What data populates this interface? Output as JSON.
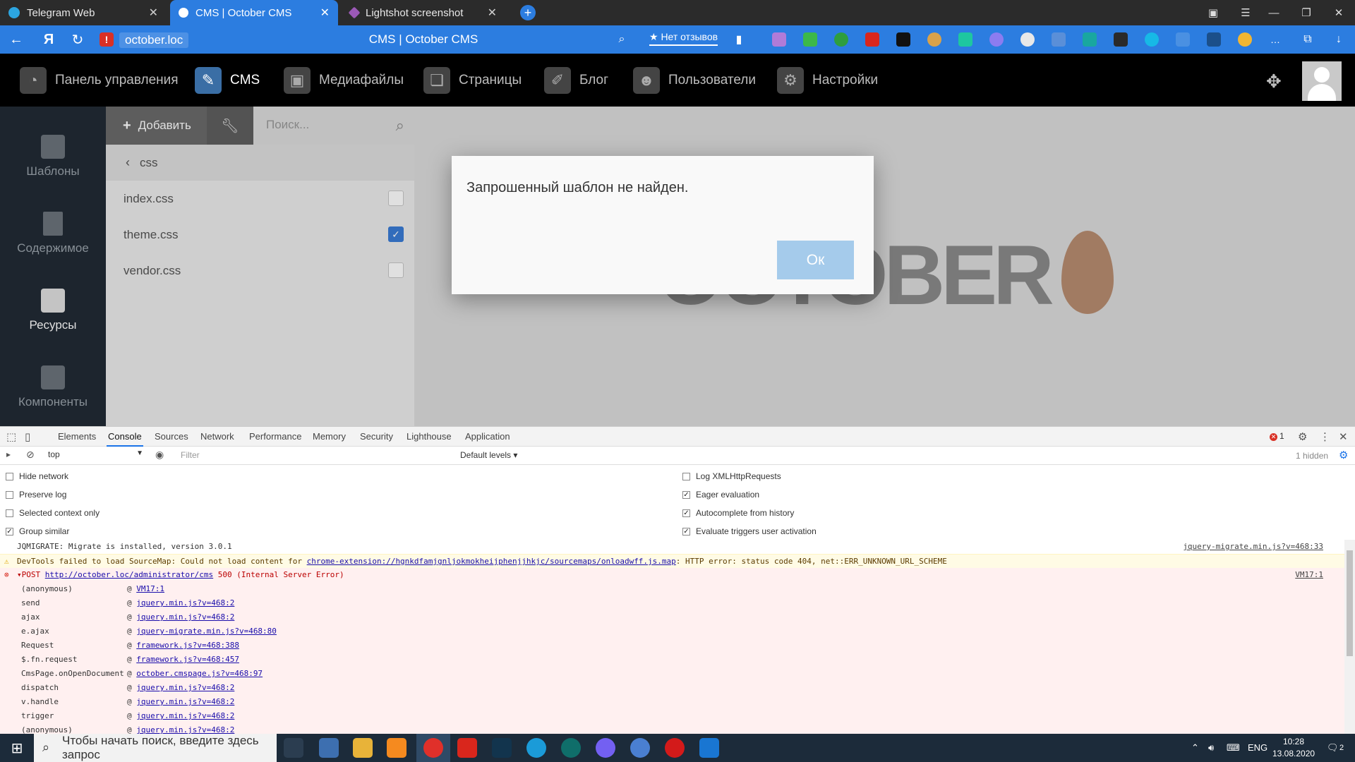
{
  "browser": {
    "tabs": [
      {
        "title": "Telegram Web",
        "color": "#2ca5e0"
      },
      {
        "title": "CMS | October CMS",
        "color": "#ffffff"
      },
      {
        "title": "Lightshot screenshot",
        "color": "#9b59b6"
      }
    ],
    "active_tab": 1,
    "address_host": "october.loc",
    "page_title": "CMS | October CMS",
    "reviews_label": "★ Нет отзывов",
    "accent": "#2c7de0"
  },
  "cms": {
    "top_menu": [
      {
        "label": "Панель управления",
        "icon": "dashboard-icon"
      },
      {
        "label": "CMS",
        "icon": "cms-icon"
      },
      {
        "label": "Медиафайлы",
        "icon": "media-icon"
      },
      {
        "label": "Страницы",
        "icon": "pages-icon"
      },
      {
        "label": "Блог",
        "icon": "blog-icon"
      },
      {
        "label": "Пользователи",
        "icon": "users-icon"
      },
      {
        "label": "Настройки",
        "icon": "settings-icon"
      }
    ],
    "left_nav": [
      {
        "label": "Шаблоны",
        "icon": "templates-icon"
      },
      {
        "label": "Содержимое",
        "icon": "content-icon"
      },
      {
        "label": "Ресурсы",
        "icon": "assets-icon"
      },
      {
        "label": "Компоненты",
        "icon": "components-icon"
      }
    ],
    "active_left_nav": 2,
    "add_label": "Добавить",
    "search_placeholder": "Поиск...",
    "folder": "css",
    "files": [
      {
        "name": "index.css",
        "checked": false
      },
      {
        "name": "theme.css",
        "checked": true
      },
      {
        "name": "vendor.css",
        "checked": false
      }
    ],
    "watermark_text": "OCTOBER"
  },
  "modal": {
    "message": "Запрошенный шаблон не найден.",
    "ok_label": "Ок"
  },
  "devtools": {
    "tabs": [
      "Elements",
      "Console",
      "Sources",
      "Network",
      "Performance",
      "Memory",
      "Security",
      "Lighthouse",
      "Application"
    ],
    "active_tab": "Console",
    "error_count": "1",
    "context": "top",
    "filter_placeholder": "Filter",
    "levels": "Default levels ▾",
    "hidden": "1 hidden",
    "options_left": [
      {
        "label": "Hide network",
        "checked": false
      },
      {
        "label": "Preserve log",
        "checked": false
      },
      {
        "label": "Selected context only",
        "checked": false
      },
      {
        "label": "Group similar",
        "checked": true
      }
    ],
    "options_right": [
      {
        "label": "Log XMLHttpRequests",
        "checked": false
      },
      {
        "label": "Eager evaluation",
        "checked": true
      },
      {
        "label": "Autocomplete from history",
        "checked": true
      },
      {
        "label": "Evaluate triggers user activation",
        "checked": true
      }
    ],
    "log_info": {
      "text": "JQMIGRATE: Migrate is installed, version 3.0.1",
      "source": "jquery-migrate.min.js?v=468:33"
    },
    "log_warn": {
      "prefix": "DevTools failed to load SourceMap: Could not load content for ",
      "url": "chrome-extension://hgnkdfamjgnljokmokheijphenjjhkjc/sourcemaps/onloadwff.js.map",
      "suffix": ": HTTP error: status code 404, net::ERR_UNKNOWN_URL_SCHEME"
    },
    "log_error": {
      "method": "▾POST ",
      "url": "http://october.loc/administrator/cms",
      "suffix": " 500 (Internal Server Error)",
      "source": "VM17:1"
    },
    "stack": [
      {
        "fn": "(anonymous)",
        "src": "VM17:1"
      },
      {
        "fn": "send",
        "src": "jquery.min.js?v=468:2"
      },
      {
        "fn": "ajax",
        "src": "jquery.min.js?v=468:2"
      },
      {
        "fn": "e.ajax",
        "src": "jquery-migrate.min.js?v=468:80"
      },
      {
        "fn": "Request",
        "src": "framework.js?v=468:388"
      },
      {
        "fn": "$.fn.request",
        "src": "framework.js?v=468:457"
      },
      {
        "fn": "CmsPage.onOpenDocument",
        "src": "october.cmspage.js?v=468:97"
      },
      {
        "fn": "dispatch",
        "src": "jquery.min.js?v=468:2"
      },
      {
        "fn": "v.handle",
        "src": "jquery.min.js?v=468:2"
      },
      {
        "fn": "trigger",
        "src": "jquery.min.js?v=468:2"
      },
      {
        "fn": "(anonymous)",
        "src": "jquery.min.js?v=468:2"
      }
    ]
  },
  "taskbar": {
    "search_placeholder": "Чтобы начать поиск, введите здесь запрос",
    "language": "ENG",
    "time": "10:28",
    "date": "13.08.2020",
    "notifications": "2"
  }
}
